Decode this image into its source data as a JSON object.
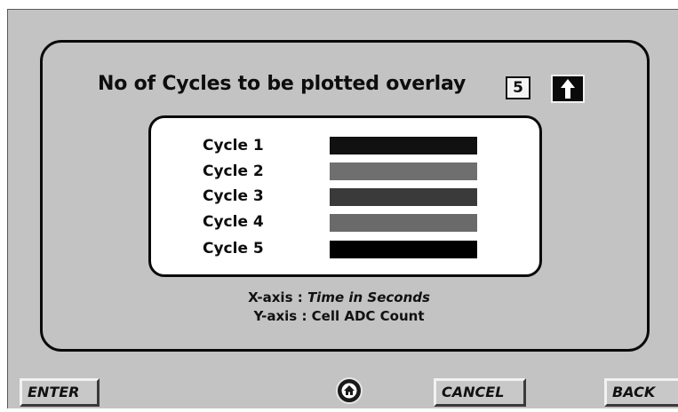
{
  "header": {
    "title": "No of Cycles to be plotted overlay",
    "cycle_count": "5",
    "up_icon": "arrow-up-icon"
  },
  "legend": {
    "items": [
      {
        "label": "Cycle 1",
        "color": "#111111"
      },
      {
        "label": "Cycle 2",
        "color": "#6f6f6f"
      },
      {
        "label": "Cycle 3",
        "color": "#3a3a3a"
      },
      {
        "label": "Cycle 4",
        "color": "#6a6a6a"
      },
      {
        "label": "Cycle 5",
        "color": "#000000"
      }
    ]
  },
  "axes": {
    "x_prefix": "X-axis : ",
    "x_text": "Time in Seconds",
    "y_text": "Y-axis : Cell ADC Count"
  },
  "footer": {
    "enter_label": "ENTER",
    "cancel_label": "CANCEL",
    "back_label": "BACK",
    "home_icon": "home-icon"
  }
}
